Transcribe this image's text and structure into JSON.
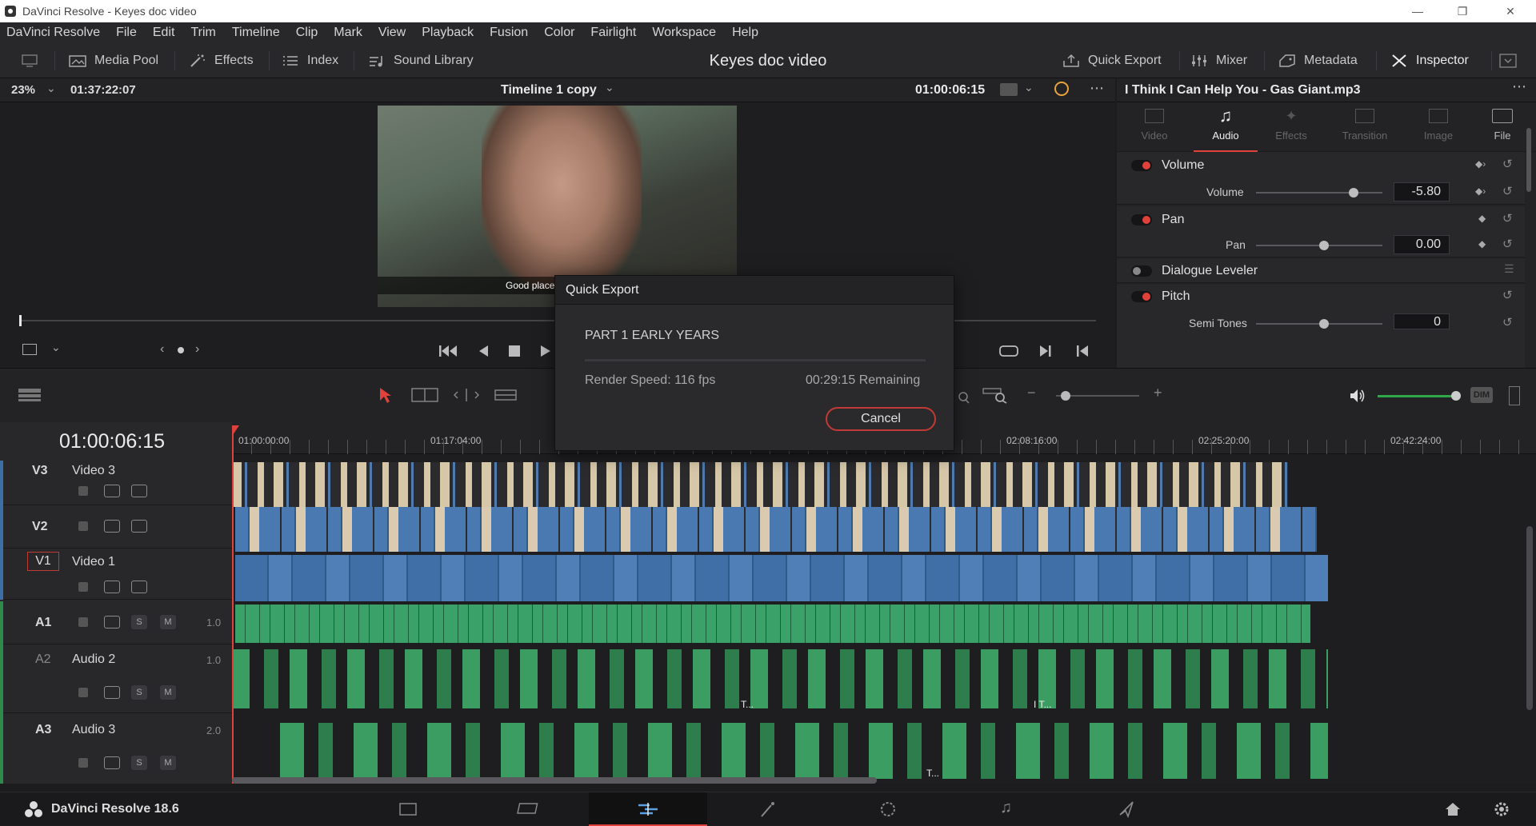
{
  "window": {
    "title": "DaVinci Resolve - Keyes doc video"
  },
  "menu": [
    "DaVinci Resolve",
    "File",
    "Edit",
    "Trim",
    "Timeline",
    "Clip",
    "Mark",
    "View",
    "Playback",
    "Fusion",
    "Color",
    "Fairlight",
    "Workspace",
    "Help"
  ],
  "toolbar": {
    "media_pool": "Media Pool",
    "effects": "Effects",
    "index": "Index",
    "sound_library": "Sound Library",
    "project_title": "Keyes doc video",
    "quick_export": "Quick Export",
    "mixer": "Mixer",
    "metadata": "Metadata",
    "inspector": "Inspector"
  },
  "viewer": {
    "zoom": "23%",
    "duration": "01:37:22:07",
    "timeline_name": "Timeline 1 copy",
    "timecode": "01:00:06:15",
    "subtitle_overlay": "Good place"
  },
  "inspector": {
    "clip_name": "I Think I Can Help You - Gas Giant.mp3",
    "tabs": [
      "Video",
      "Audio",
      "Effects",
      "Transition",
      "Image",
      "File"
    ],
    "active_tab": "Audio",
    "volume_header": "Volume",
    "volume_label": "Volume",
    "volume_value": "-5.80",
    "pan_header": "Pan",
    "pan_label": "Pan",
    "pan_value": "0.00",
    "dialogue_leveler": "Dialogue Leveler",
    "pitch_header": "Pitch",
    "semitones_label": "Semi Tones",
    "semitones_value": "0",
    "accent_color": "#e0413b"
  },
  "timeline": {
    "current_timecode": "01:00:06:15",
    "ruler": [
      "01:00:00:00",
      "01:17:04:00",
      "02:08:16:00",
      "02:25:20:00",
      "02:42:24:00"
    ],
    "tracks": [
      {
        "id": "V3",
        "name": "Video 3"
      },
      {
        "id": "V2",
        "name": ""
      },
      {
        "id": "V1",
        "name": "Video 1"
      },
      {
        "id": "A1",
        "name": "",
        "level": "1.0"
      },
      {
        "id": "A2",
        "name": "Audio 2",
        "level": "1.0"
      },
      {
        "id": "A3",
        "name": "Audio 3",
        "level": "2.0"
      }
    ],
    "clip_labels": [
      "T...",
      "I T...",
      "T..."
    ],
    "solo": "S",
    "mute": "M",
    "dim": "DIM"
  },
  "quick_export": {
    "title": "Quick Export",
    "job_name": "PART 1 EARLY YEARS",
    "render_speed": "Render Speed: 116 fps",
    "remaining": "00:29:15 Remaining",
    "cancel": "Cancel",
    "progress": 0
  },
  "footer": {
    "app_version": "DaVinci Resolve 18.6",
    "pages": [
      "media-page",
      "cut-page",
      "edit-page",
      "fusion-page",
      "color-page",
      "fairlight-page",
      "deliver-page"
    ],
    "active_page": "edit-page"
  }
}
